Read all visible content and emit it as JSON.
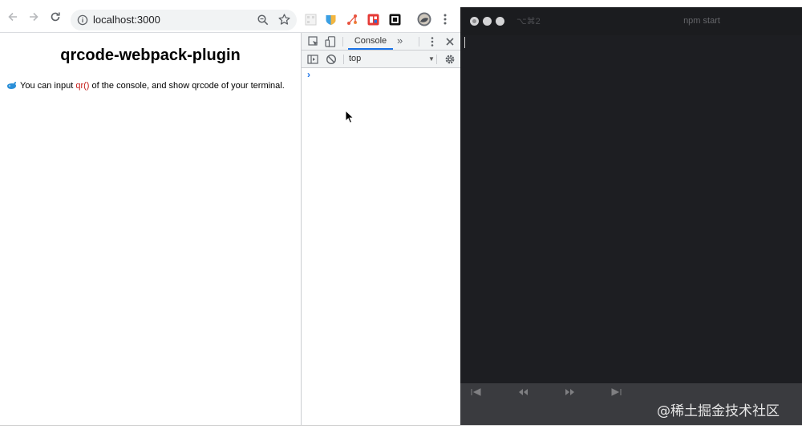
{
  "browser": {
    "url": "localhost:3000",
    "icons": {
      "back": "arrow-left-icon",
      "forward": "arrow-right-icon",
      "reload": "reload-icon",
      "info": "info-icon",
      "zoom": "magnifier-icon",
      "bookmark": "star-icon",
      "extensions": [
        "qr-extension-icon",
        "shield-extension-icon",
        "network-extension-icon",
        "red-extension-icon",
        "square-extension-icon",
        "profile-avatar-icon",
        "kebab-menu-icon"
      ]
    }
  },
  "page": {
    "title": "qrcode-webpack-plugin",
    "line_before": "You can input ",
    "line_code": "qr()",
    "line_after": " of the console, and show qrcode of your terminal."
  },
  "devtools": {
    "tab_console": "Console",
    "more_tabs": "»",
    "context": "top",
    "prompt": "›"
  },
  "terminal": {
    "shortcut": "⌥⌘2",
    "title": "npm start"
  },
  "watermark": "@稀土掘金技术社区",
  "colors": {
    "code": "#c41a16",
    "accent": "#1a73e8",
    "terminal_bg": "#1d1e22"
  }
}
